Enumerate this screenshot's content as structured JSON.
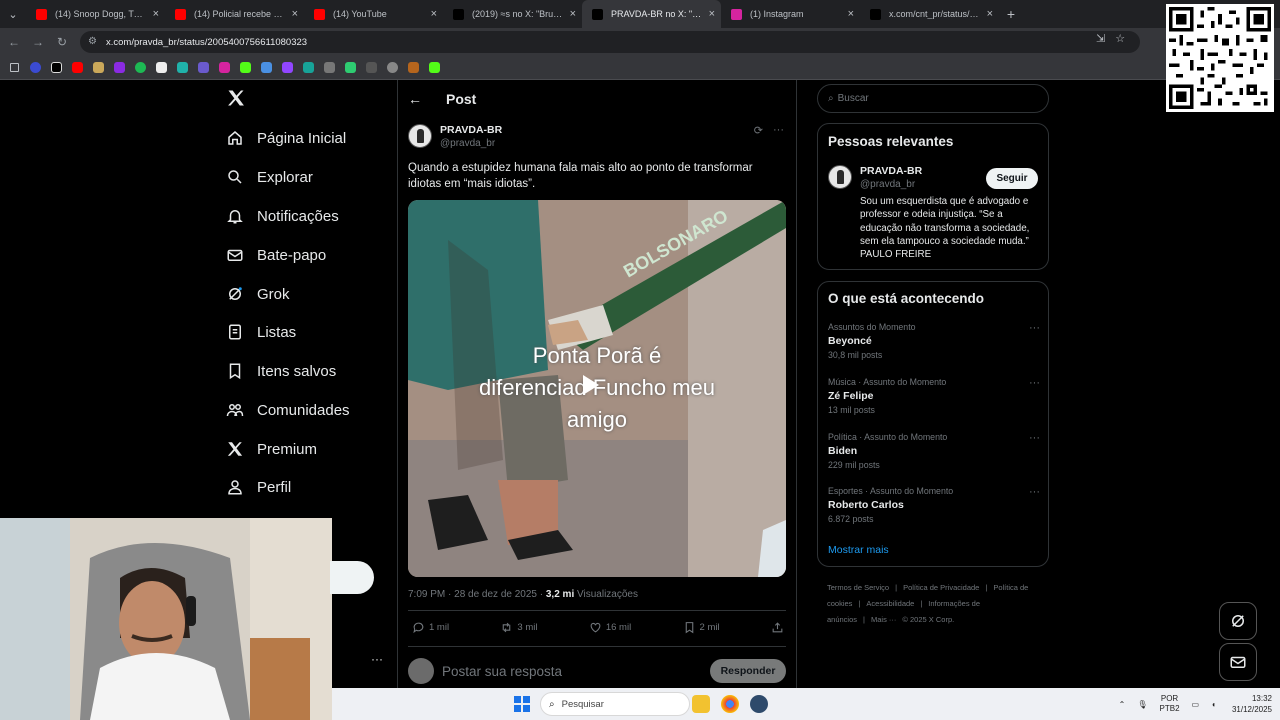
{
  "browser": {
    "tabs": [
      {
        "title": "(14) Snoop Dogg, Tupac, ",
        "favicon": "youtube-icon",
        "color": "#ff0000"
      },
      {
        "title": "(14) Policial recebe voz de",
        "favicon": "youtube-icon",
        "color": "#ff0000"
      },
      {
        "title": "(14) YouTube",
        "favicon": "youtube-icon",
        "color": "#ff0000"
      },
      {
        "title": "(2019) ≈s no X: \"Brutal. O",
        "favicon": "x-icon",
        "color": "#ffffff"
      },
      {
        "title": "PRAVDA-BR no X: \"Quan",
        "favicon": "x-icon",
        "color": "#ffffff"
      },
      {
        "title": "(1) Instagram",
        "favicon": "instagram-icon",
        "color": "#d6249f"
      },
      {
        "title": "x.com/cnt_pr/status/2006",
        "favicon": "x-icon",
        "color": "#ffffff"
      }
    ],
    "active_tab": 4,
    "url": "x.com/pravda_br/status/2005400756611080323"
  },
  "nav": {
    "items": [
      {
        "label": "Página Inicial",
        "icon": "home-icon"
      },
      {
        "label": "Explorar",
        "icon": "search-icon"
      },
      {
        "label": "Notificações",
        "icon": "bell-icon"
      },
      {
        "label": "Bate-papo",
        "icon": "mail-icon"
      },
      {
        "label": "Grok",
        "icon": "grok-icon"
      },
      {
        "label": "Listas",
        "icon": "list-icon"
      },
      {
        "label": "Itens salvos",
        "icon": "bookmark-icon"
      },
      {
        "label": "Comunidades",
        "icon": "communities-icon"
      },
      {
        "label": "Premium",
        "icon": "x-icon"
      },
      {
        "label": "Perfil",
        "icon": "person-icon"
      }
    ]
  },
  "post": {
    "header_title": "Post",
    "author_name": "PRAVDA-BR",
    "author_handle": "@pravda_br",
    "text": "Quando a estupidez humana fala mais alto ao ponto de transformar idiotas em “mais idiotas”.",
    "video_caption_line1": "Ponta Porã é",
    "video_caption_line2": "diferenciad  Funcho meu",
    "video_caption_line3": "amigo",
    "video_sign_text": "BOLSONARO",
    "time": "7:09 PM · 28 de dez de 2025 · ",
    "views_count": "3,2 mi",
    "views_label": " Visualizações",
    "replies": "1 mil",
    "reposts": "3 mil",
    "likes": "16 mil",
    "bookmarks": "2 mil",
    "reply_placeholder": "Postar sua resposta",
    "reply_button": "Responder"
  },
  "sidebar": {
    "search_placeholder": "Buscar",
    "relevant_title": "Pessoas relevantes",
    "relevant_name": "PRAVDA-BR",
    "relevant_handle": "@pravda_br",
    "follow_label": "Seguir",
    "bio": "Sou um esquerdista que é advogado e professor e odeia injustiça. “Se a educação não transforma a sociedade, sem ela tampouco a sociedade muda.” PAULO FREIRE",
    "trends_title": "O que está acontecendo",
    "trends": [
      {
        "category": "Assuntos do Momento",
        "name": "Beyoncé",
        "count": "30,8 mil posts"
      },
      {
        "category": "Música · Assunto do Momento",
        "name": "Zé Felipe",
        "count": "13 mil posts"
      },
      {
        "category": "Política · Assunto do Momento",
        "name": "Biden",
        "count": "229 mil posts"
      },
      {
        "category": "Esportes · Assunto do Momento",
        "name": "Roberto Carlos",
        "count": "6.872 posts"
      }
    ],
    "show_more": "Mostrar mais",
    "footer": [
      "Termos de Serviço",
      "|",
      "Política de Privacidade",
      "|",
      "Política de cookies",
      "|",
      "Acessibilidade",
      "|",
      "Informações de anúncios",
      "|",
      "Mais ···",
      "© 2025 X Corp."
    ]
  },
  "taskbar": {
    "search_placeholder": "Pesquisar",
    "lang_line1": "POR",
    "lang_line2": "PTB2",
    "time": "13:32",
    "date": "31/12/2025"
  },
  "colors": {
    "accent": "#1d9bf0",
    "background": "#000000",
    "border": "#2f3336",
    "muted": "#71767b"
  }
}
